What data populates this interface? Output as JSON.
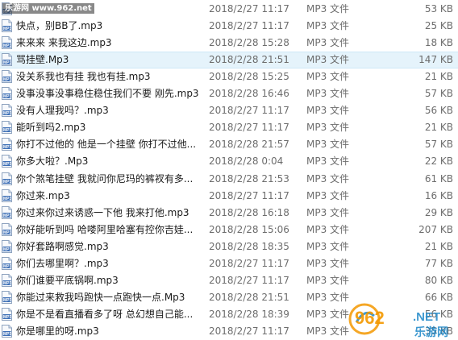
{
  "watermark": {
    "site_text": "乐游网 www.962.net",
    "logo_number": "962",
    "logo_suffix": ".NET",
    "logo_caption": "乐游网"
  },
  "files": [
    {
      "name": "",
      "date": "2018/2/27 11:17",
      "type": "MP3 文件",
      "size": "53 KB"
    },
    {
      "name": "快点，别BB了.mp3",
      "date": "2018/2/27 11:17",
      "type": "MP3 文件",
      "size": "25 KB"
    },
    {
      "name": "来来来 来我这边.mp3",
      "date": "2018/2/28 15:28",
      "type": "MP3 文件",
      "size": "18 KB"
    },
    {
      "name": "骂挂壁.Mp3",
      "date": "2018/2/28 21:51",
      "type": "MP3 文件",
      "size": "147 KB",
      "selected": true
    },
    {
      "name": "没关系我也有挂 我也有挂.mp3",
      "date": "2018/2/28 15:25",
      "type": "MP3 文件",
      "size": "21 KB"
    },
    {
      "name": "没事没事没事稳住稳住我们不要 刚先.mp3",
      "date": "2018/2/28 16:46",
      "type": "MP3 文件",
      "size": "57 KB"
    },
    {
      "name": "没有人理我吗？.mp3",
      "date": "2018/2/27 11:17",
      "type": "MP3 文件",
      "size": "56 KB"
    },
    {
      "name": "能听到吗2.mp3",
      "date": "2018/2/27 11:17",
      "type": "MP3 文件",
      "size": "21 KB"
    },
    {
      "name": "你打不过他的 他是一个挂壁 你打不过他...",
      "date": "2018/2/28 21:57",
      "type": "MP3 文件",
      "size": "57 KB"
    },
    {
      "name": "你多大啦？.Mp3",
      "date": "2018/2/28 0:04",
      "type": "MP3 文件",
      "size": "22 KB"
    },
    {
      "name": "你个煞笔挂壁 我就问你尼玛的裤衩有多...",
      "date": "2018/2/28 21:53",
      "type": "MP3 文件",
      "size": "61 KB"
    },
    {
      "name": "你过来.mp3",
      "date": "2018/2/27 11:17",
      "type": "MP3 文件",
      "size": "16 KB"
    },
    {
      "name": "你过来你过来诱惑一下他 我来打他.mp3",
      "date": "2018/2/28 16:18",
      "type": "MP3 文件",
      "size": "29 KB"
    },
    {
      "name": "你好能听到吗 哈喽阿里哈塞有控你吉娃...",
      "date": "2018/2/28 15:06",
      "type": "MP3 文件",
      "size": "207 KB"
    },
    {
      "name": "你好套路啊感觉.mp3",
      "date": "2018/2/28 18:35",
      "type": "MP3 文件",
      "size": "21 KB"
    },
    {
      "name": "你们去哪里啊？.mp3",
      "date": "2018/2/27 11:17",
      "type": "MP3 文件",
      "size": "77 KB"
    },
    {
      "name": "你们谁要平底锅啊.mp3",
      "date": "2018/2/27 11:17",
      "type": "MP3 文件",
      "size": "80 KB"
    },
    {
      "name": "你能过来救我吗跑快一点跑快一点.Mp3",
      "date": "2018/2/28 21:51",
      "type": "MP3 文件",
      "size": "66 KB"
    },
    {
      "name": "你是不是看直播看多了呀 总幻想自己能...",
      "date": "2018/2/28 18:39",
      "type": "MP3 文件",
      "size": "56 KB"
    },
    {
      "name": "你是哪里的呀.mp3",
      "date": "2018/2/27 11:17",
      "type": "MP3 文件",
      "size": "35 KB"
    }
  ],
  "colors": {
    "selected_bg": "#e5f3fb",
    "text_main": "#1a1a1a",
    "text_meta": "#6d6d6d",
    "logo_orange": "#f39800",
    "logo_blue": "#1e88c8"
  }
}
